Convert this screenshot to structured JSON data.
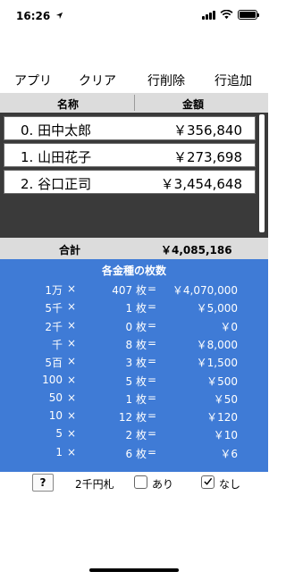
{
  "status": {
    "time": "16:26",
    "location_icon": "location-arrow-icon"
  },
  "toolbar": {
    "app": "アプリ",
    "clear": "クリア",
    "delete_row": "行削除",
    "add_row": "行追加"
  },
  "columns": {
    "name": "名称",
    "amount": "金額"
  },
  "rows": [
    {
      "name": "0. 田中太郎",
      "amount": "￥356,840"
    },
    {
      "name": "1. 山田花子",
      "amount": "￥273,698"
    },
    {
      "name": "2. 谷口正司",
      "amount": "￥3,454,648"
    }
  ],
  "total": {
    "label": "合計",
    "value": "￥4,085,186"
  },
  "breakdown": {
    "title": "各金種の枚数",
    "times": "×",
    "unit": "枚",
    "equals": "=",
    "items": [
      {
        "denom": "1万",
        "count": "407",
        "subtotal": "￥4,070,000"
      },
      {
        "denom": "5千",
        "count": "1",
        "subtotal": "￥5,000"
      },
      {
        "denom": "2千",
        "count": "0",
        "subtotal": "￥0"
      },
      {
        "denom": "千",
        "count": "8",
        "subtotal": "￥8,000"
      },
      {
        "denom": "5百",
        "count": "3",
        "subtotal": "￥1,500"
      },
      {
        "denom": "100",
        "count": "5",
        "subtotal": "￥500"
      },
      {
        "denom": "50",
        "count": "1",
        "subtotal": "￥50"
      },
      {
        "denom": "10",
        "count": "12",
        "subtotal": "￥120"
      },
      {
        "denom": "5",
        "count": "2",
        "subtotal": "￥10"
      },
      {
        "denom": "1",
        "count": "6",
        "subtotal": "￥6"
      }
    ]
  },
  "bottom": {
    "help": "?",
    "two_thousand_label": "2千円札",
    "option_yes": "あり",
    "option_no": "なし",
    "yes_checked": false,
    "no_checked": true
  },
  "colors": {
    "breakdown_bg": "#3f7bd6",
    "header_bg": "#dcdcdc",
    "list_bg": "#3a3a3a"
  }
}
